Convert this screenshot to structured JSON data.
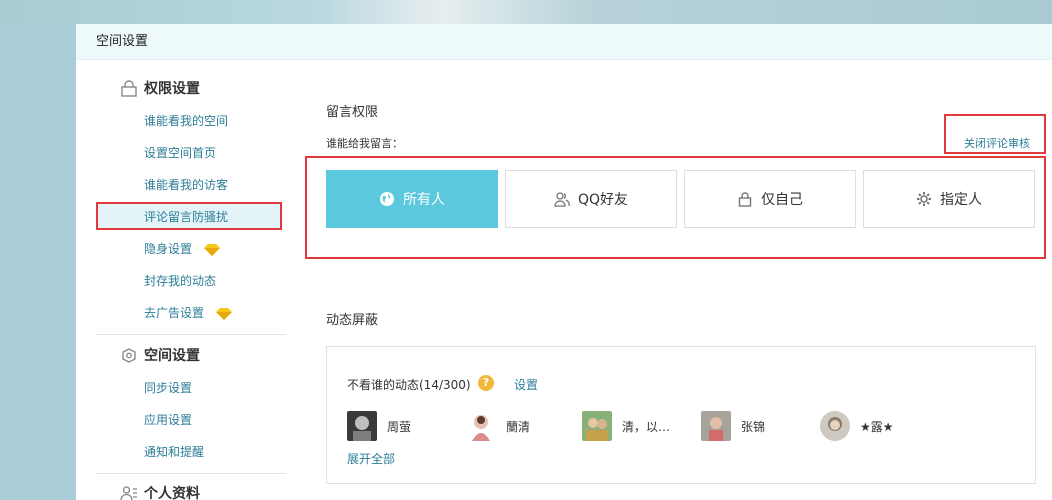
{
  "panel": {
    "title": "空间设置"
  },
  "sidebar": {
    "groups": [
      {
        "title": "权限设置",
        "icon": "lock-icon",
        "items": [
          {
            "label": "谁能看我的空间"
          },
          {
            "label": "设置空间首页"
          },
          {
            "label": "谁能看我的访客"
          },
          {
            "label": "评论留言防骚扰",
            "active": true
          },
          {
            "label": "隐身设置",
            "badge": "diamond-icon"
          },
          {
            "label": "封存我的动态"
          },
          {
            "label": "去广告设置",
            "badge": "diamond-icon"
          }
        ]
      },
      {
        "title": "空间设置",
        "icon": "space-settings-icon",
        "items": [
          {
            "label": "同步设置"
          },
          {
            "label": "应用设置"
          },
          {
            "label": "通知和提醒"
          }
        ]
      },
      {
        "title": "个人资料",
        "icon": "profile-icon",
        "items": []
      }
    ]
  },
  "message_permission": {
    "title": "留言权限",
    "who_label": "谁能给我留言：",
    "close_review_link": "关闭评论审核",
    "options": [
      {
        "label": "所有人",
        "icon": "globe-icon",
        "selected": true
      },
      {
        "label": "QQ好友",
        "icon": "friends-icon",
        "selected": false
      },
      {
        "label": "仅自己",
        "icon": "lock-icon",
        "selected": false
      },
      {
        "label": "指定人",
        "icon": "gear-icon",
        "selected": false
      }
    ]
  },
  "feed_block": {
    "title": "动态屏蔽",
    "hidden_label": "不看谁的动态(14/300)",
    "help_icon": "?",
    "settings_link": "设置",
    "friends": [
      {
        "name": "周萤"
      },
      {
        "name": "蘭清"
      },
      {
        "name": "清，以…"
      },
      {
        "name": "张锦"
      },
      {
        "name": "★露★"
      }
    ],
    "expand_link": "展开全部"
  },
  "colors": {
    "accent": "#5bc8de",
    "link": "#2c7e99",
    "highlight_border": "#e0393e",
    "header_bg": "#eef9fc",
    "page_bg": "#a9cdd6"
  }
}
